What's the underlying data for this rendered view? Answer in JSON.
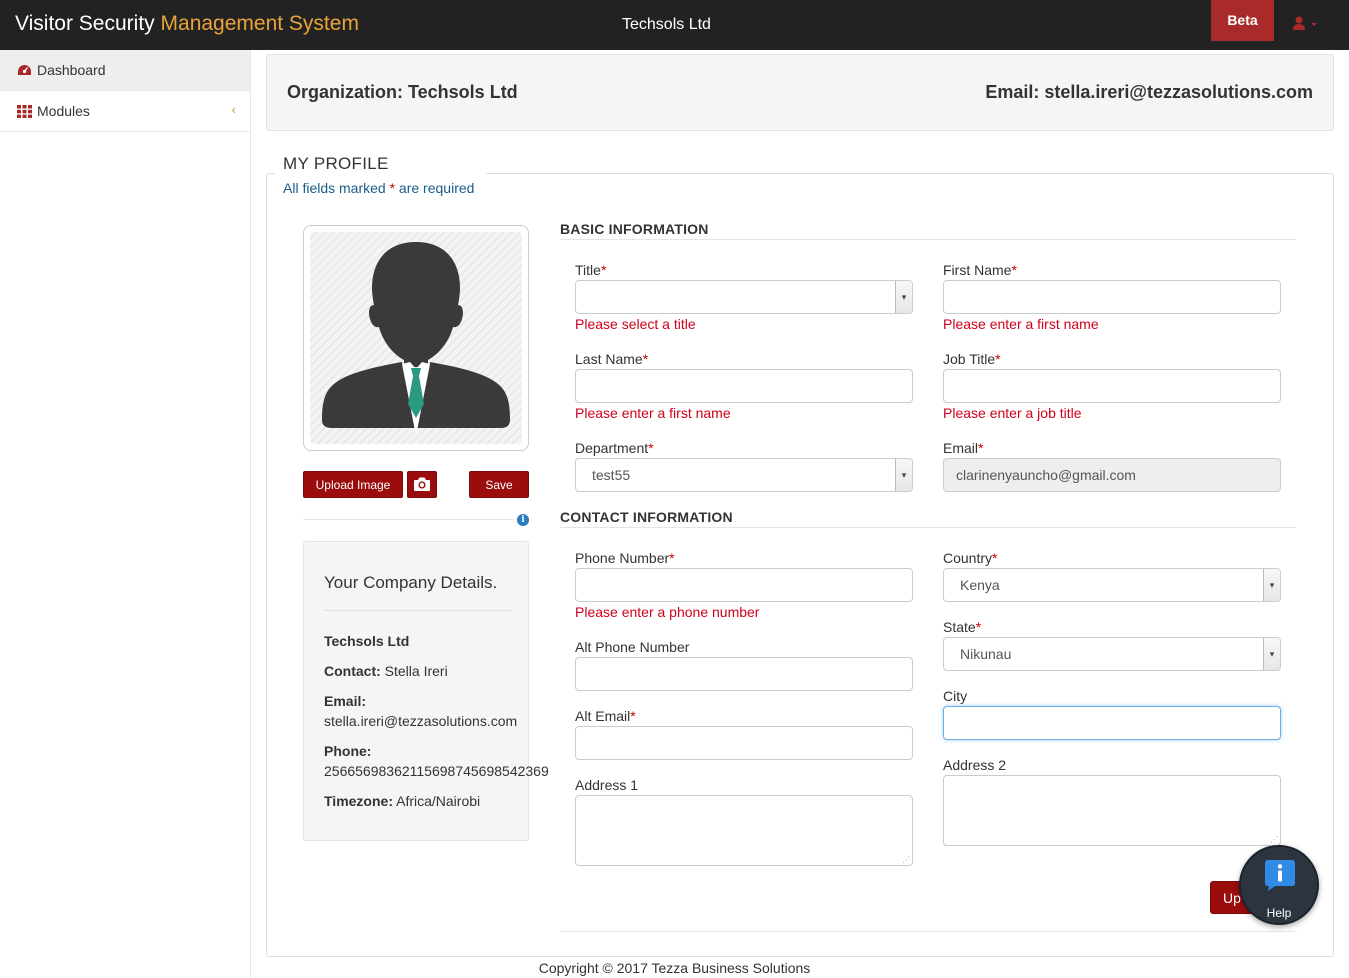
{
  "navbar": {
    "brand_main": "Visitor Security",
    "brand_accent": "Management System",
    "center_title": "Techsols Ltd",
    "beta_label": "Beta",
    "user_icon": "user-icon"
  },
  "sidebar": {
    "items": [
      {
        "label": "Dashboard",
        "icon": "dashboard-icon"
      },
      {
        "label": "Modules",
        "icon": "grid-icon"
      }
    ]
  },
  "org": {
    "organization": "Organization: Techsols Ltd",
    "email": "Email: stella.ireri@tezzasolutions.com"
  },
  "profile": {
    "title": "MY PROFILE",
    "note_prefix": "All fields marked ",
    "note_star": "*",
    "note_suffix": " are required"
  },
  "avatar": {
    "upload_label": "Upload Image",
    "save_label": "Save"
  },
  "company": {
    "heading": "Your Company Details.",
    "name": "Techsols Ltd",
    "contact_key": "Contact:",
    "contact_value": "Stella Ireri",
    "email_key": "Email:",
    "email_value": "stella.ireri@tezzasolutions.com",
    "phone_key": "Phone:",
    "phone_value": "25665698362115698745698542369",
    "timezone_key": "Timezone:",
    "timezone_value": "Africa/Nairobi"
  },
  "basic": {
    "heading": "BASIC INFORMATION",
    "title_label": "Title",
    "title_value": "",
    "title_error": "Please select a title",
    "first_name_label": "First Name",
    "first_name_value": "",
    "first_name_error": "Please enter a first name",
    "last_name_label": "Last Name",
    "last_name_value": "",
    "last_name_error": "Please enter a first name",
    "job_title_label": "Job Title",
    "job_title_value": "",
    "job_title_error": "Please enter a job title",
    "department_label": "Department",
    "department_value": "test55",
    "email_label": "Email",
    "email_value": "clarinenyauncho@gmail.com"
  },
  "contact": {
    "heading": "CONTACT INFORMATION",
    "phone_label": "Phone Number",
    "phone_value": "",
    "phone_error": "Please enter a phone number",
    "country_label": "Country",
    "country_value": "Kenya",
    "alt_phone_label": "Alt Phone Number",
    "alt_phone_value": "",
    "state_label": "State",
    "state_value": "Nikunau",
    "city_label": "City",
    "city_value": "",
    "alt_email_label": "Alt Email",
    "alt_email_value": "",
    "address1_label": "Address 1",
    "address2_label": "Address 2",
    "update_label": "Up"
  },
  "help": {
    "label": "Help"
  },
  "footer": {
    "text": "Copyright © 2017 Tezza Business Solutions"
  }
}
